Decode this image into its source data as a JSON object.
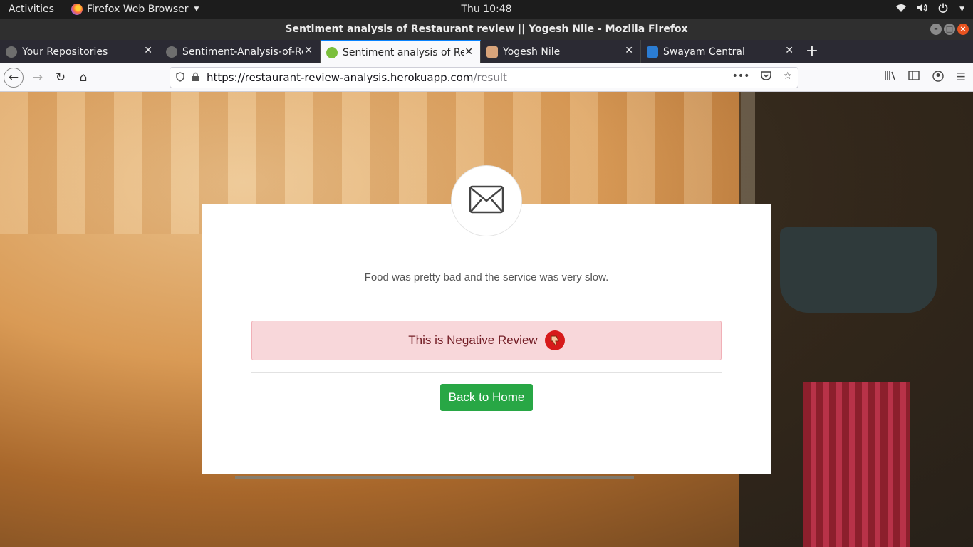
{
  "system_bar": {
    "activities": "Activities",
    "app_name": "Firefox Web Browser",
    "clock": "Thu 10:48"
  },
  "window": {
    "title": "Sentiment analysis of Restaurant review || Yogesh Nile - Mozilla Firefox"
  },
  "tabs": [
    {
      "title": "Your Repositories",
      "icon": "github-icon",
      "active": false
    },
    {
      "title": "Sentiment-Analysis-of-Re",
      "icon": "github-icon",
      "active": false
    },
    {
      "title": "Sentiment analysis of Re",
      "icon": "site-favicon",
      "active": true
    },
    {
      "title": "Yogesh Nile",
      "icon": "person-icon",
      "active": false
    },
    {
      "title": "Swayam Central",
      "icon": "swayam-icon",
      "active": false
    }
  ],
  "address_bar": {
    "url_host": "https://restaurant-review-analysis.herokuapp.com",
    "url_path": "/result"
  },
  "result_card": {
    "review_text": "Food was pretty bad and the service was very slow.",
    "sentiment_label": "This is Negative Review",
    "button_label": "Back to Home"
  },
  "colors": {
    "alert_bg": "#f8d7da",
    "alert_text": "#721c24",
    "button_bg": "#28a745",
    "thumb_icon_bg": "#d71a1a"
  }
}
